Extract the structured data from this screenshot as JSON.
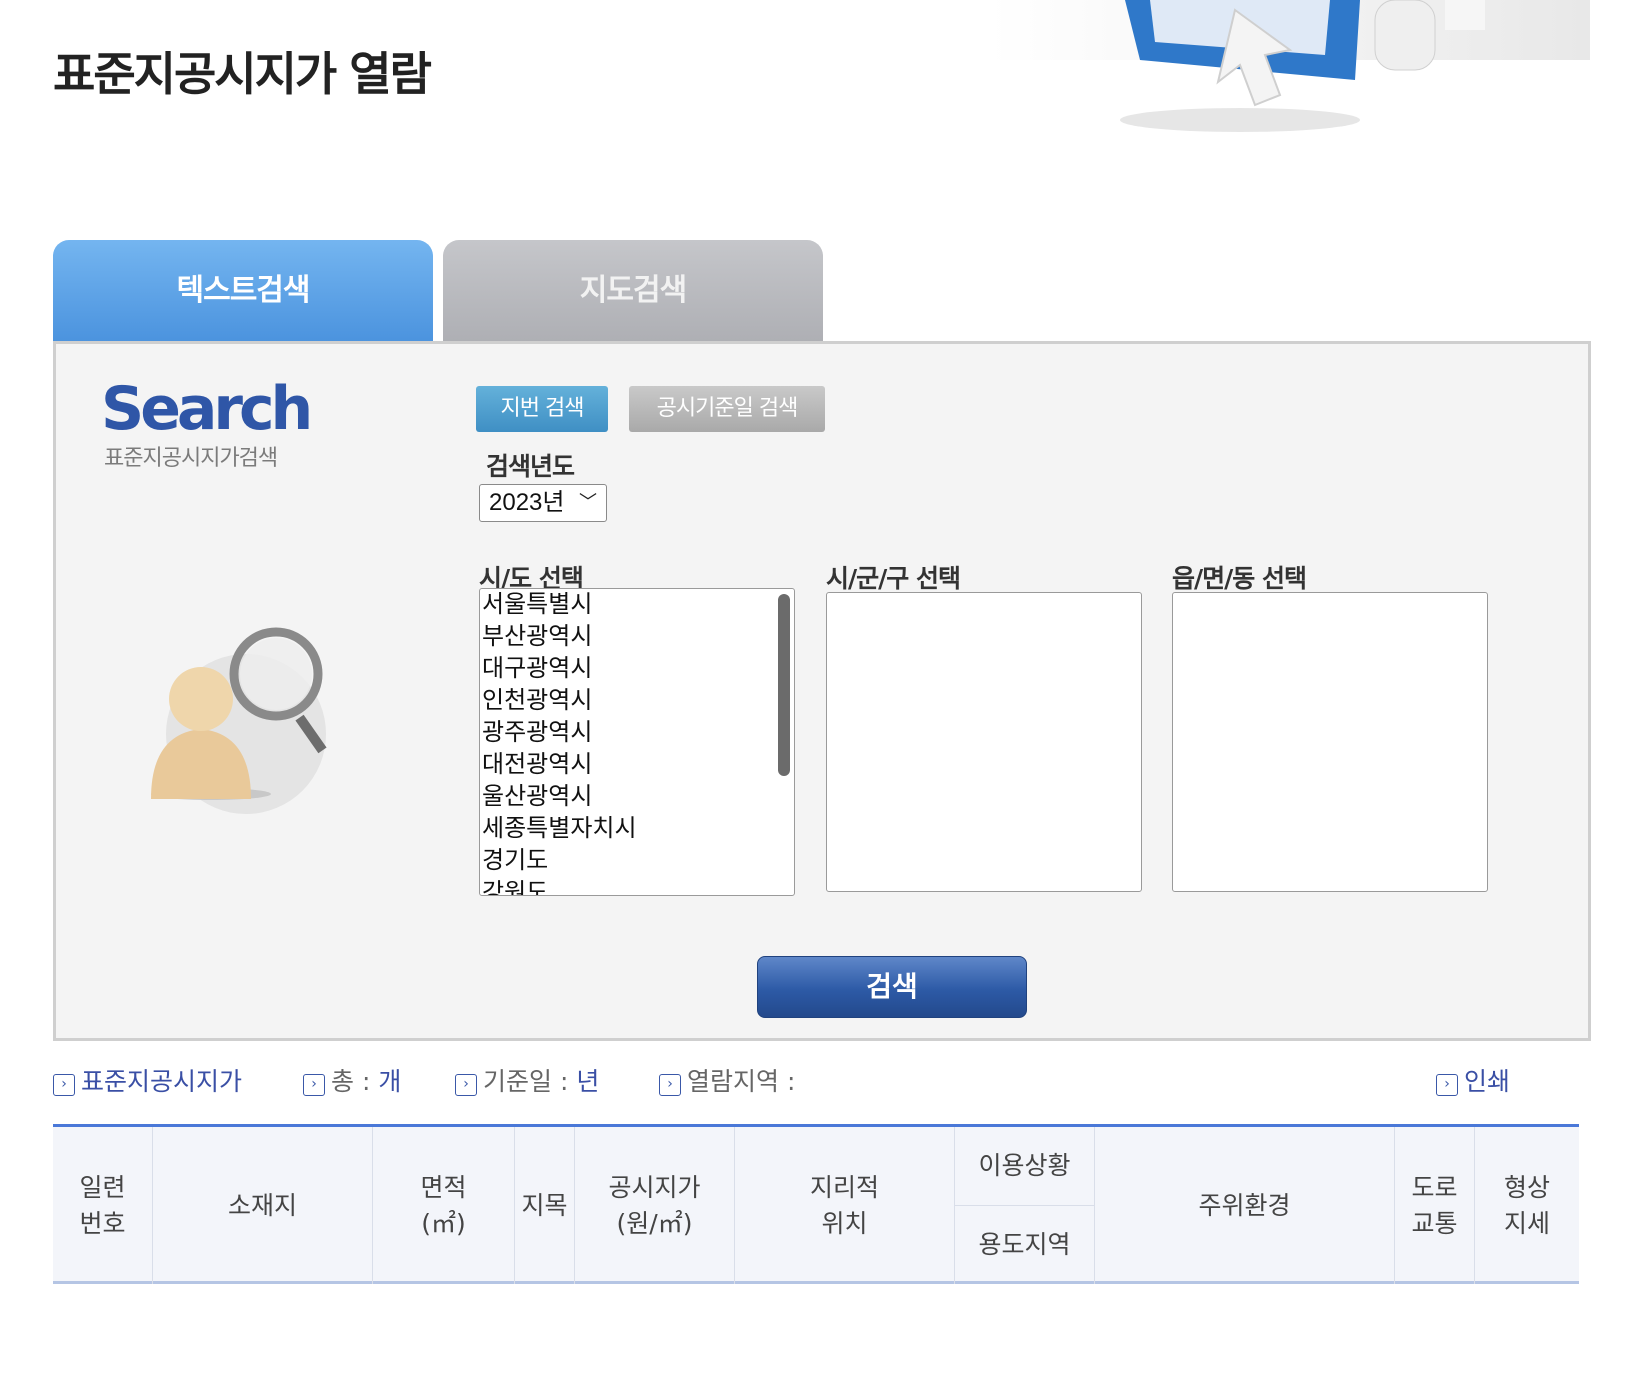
{
  "page": {
    "title": "표준지공시지가 열람"
  },
  "tabs": [
    {
      "label": "텍스트검색",
      "active": true
    },
    {
      "label": "지도검색",
      "active": false
    }
  ],
  "search_panel": {
    "logo": "Search",
    "logo_sub": "표준지공시지가검색",
    "sub_tabs": [
      {
        "label": "지번 검색",
        "active": true
      },
      {
        "label": "공시기준일 검색",
        "active": false
      }
    ],
    "year_label": "검색년도",
    "year_value": "2023년",
    "sido_label": "시/도 선택",
    "sigungu_label": "시/군/구 선택",
    "eupmyeondong_label": "읍/면/동 선택",
    "sido_options": [
      "서울특별시",
      "부산광역시",
      "대구광역시",
      "인천광역시",
      "광주광역시",
      "대전광역시",
      "울산광역시",
      "세종특별자치시",
      "경기도",
      "강원도"
    ],
    "search_button": "검색"
  },
  "info_bar": {
    "title": "표준지공시지가",
    "total_label": "총 :",
    "total_unit": "개",
    "base_date_label": "기준일 :",
    "base_date_unit": "년",
    "region_label": "열람지역 :",
    "print": "인쇄"
  },
  "table": {
    "headers": {
      "serial": [
        "일련",
        "번호"
      ],
      "location": "소재지",
      "area": [
        "면적",
        "(㎡)"
      ],
      "land_category": "지목",
      "price": [
        "공시지가",
        "(원/㎡)"
      ],
      "geo_position": [
        "지리적",
        "위치"
      ],
      "usage_status": "이용상황",
      "zoning": "용도지역",
      "surroundings": "주위환경",
      "road": [
        "도로",
        "교통"
      ],
      "shape": [
        "형상",
        "지세"
      ]
    }
  },
  "colors": {
    "tab_active": "#5aa2e6",
    "tab_inactive": "#b8b9be",
    "primary_button": "#2d5aa6",
    "link_blue": "#3a4fa5",
    "table_top_border": "#4a78d8"
  },
  "icons": [
    "arrow-box-icon",
    "chevron-down-icon"
  ]
}
